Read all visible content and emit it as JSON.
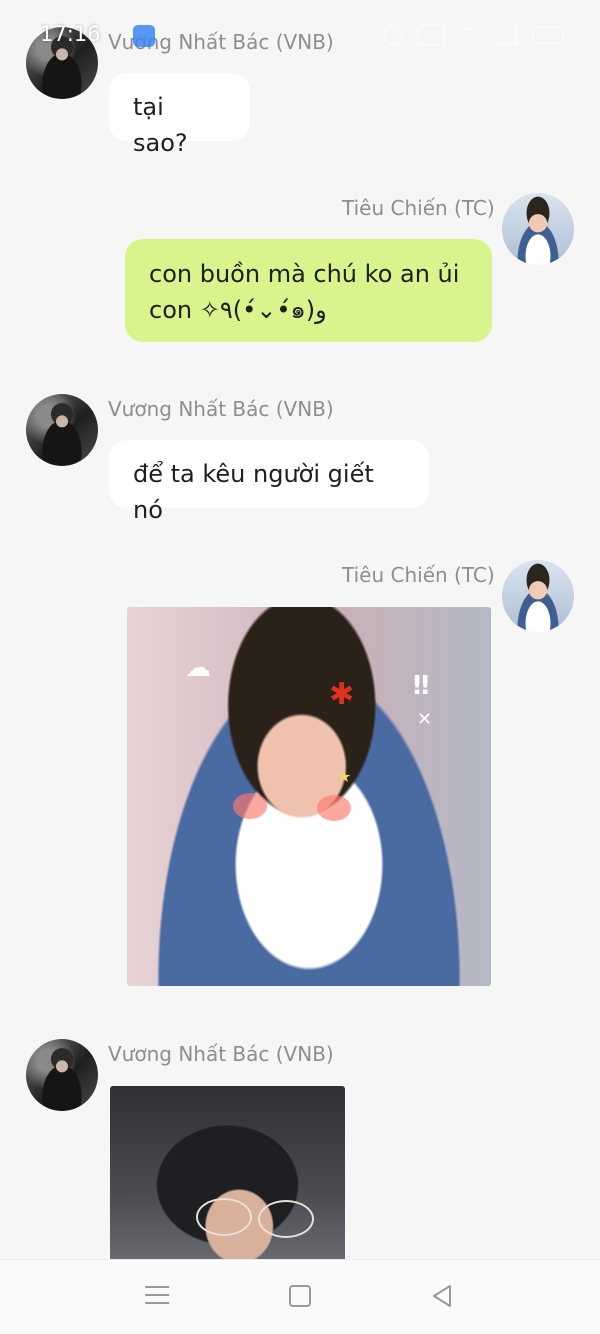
{
  "status_bar": {
    "time": "17:16"
  },
  "messages": [
    {
      "sender": "Vương Nhất Bác (VNB)",
      "direction": "incoming",
      "text": "tại sao?"
    },
    {
      "sender": "Tiêu Chiến (TC)",
      "direction": "outgoing",
      "text_line1": "con buồn mà chú ko an ủi",
      "text_line2": "con ✧٩(•́⌄•́๑)و"
    },
    {
      "sender": "Vương Nhất Bác (VNB)",
      "direction": "incoming",
      "text": "để ta kêu người giết nó"
    },
    {
      "sender": "Tiêu Chiến (TC)",
      "direction": "outgoing",
      "image": "angry-sticker-photo"
    },
    {
      "sender": "Vương Nhất Bác (VNB)",
      "direction": "incoming",
      "image": "portrait-photo"
    }
  ],
  "nav_bar": {
    "icons": [
      "menu-icon",
      "home-icon",
      "back-icon"
    ]
  },
  "colors": {
    "background": "#f6f6f6",
    "incoming_bubble": "#ffffff",
    "outgoing_bubble": "#d7f58c",
    "name_text": "#8e8e8e"
  }
}
